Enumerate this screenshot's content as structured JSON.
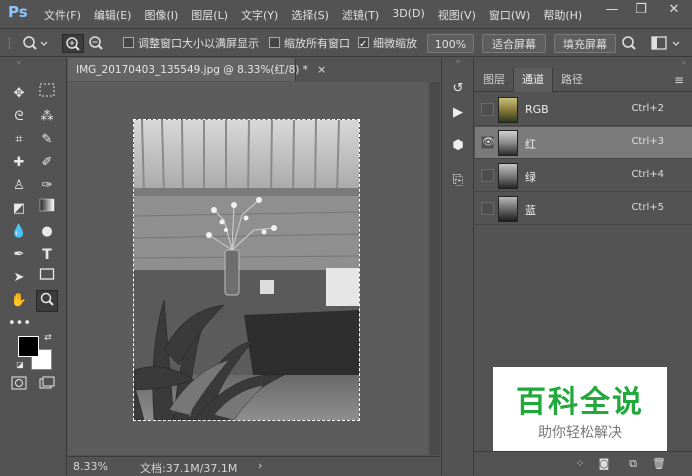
{
  "app": {
    "logo": "Ps"
  },
  "menu": [
    "文件(F)",
    "编辑(E)",
    "图像(I)",
    "图层(L)",
    "文字(Y)",
    "选择(S)",
    "滤镜(T)",
    "3D(D)",
    "视图(V)",
    "窗口(W)",
    "帮助(H)"
  ],
  "options": {
    "resize_windows": "调整窗口大小以满屏显示",
    "zoom_all": "缩放所有窗口",
    "scrubby_zoom": "细微缩放",
    "zoom_value": "100%",
    "fit_screen": "适合屏幕",
    "fill_screen": "填充屏幕"
  },
  "document": {
    "tab_title": "IMG_20170403_135549.jpg @ 8.33%(红/8) *",
    "tab_close": "×",
    "zoom": "8.33%",
    "doc_size": "文档:37.1M/37.1M"
  },
  "panel": {
    "tabs": [
      "图层",
      "通道",
      "路径"
    ],
    "channels": [
      {
        "name": "RGB",
        "shortcut": "Ctrl+2",
        "visible": false
      },
      {
        "name": "红",
        "shortcut": "Ctrl+3",
        "visible": true
      },
      {
        "name": "绿",
        "shortcut": "Ctrl+4",
        "visible": false
      },
      {
        "name": "蓝",
        "shortcut": "Ctrl+5",
        "visible": false
      }
    ]
  },
  "watermark": {
    "title": "百科全说",
    "subtitle": "助你轻松解决"
  },
  "colors": {
    "accent_green": "#22a83b",
    "ps_blue": "#8dc5ff"
  }
}
